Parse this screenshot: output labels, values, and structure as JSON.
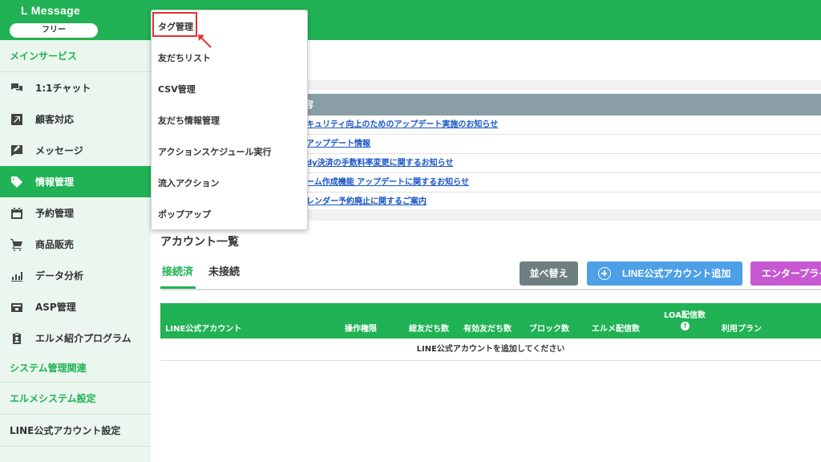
{
  "brand": {
    "name": "L Message",
    "plan": "フリー"
  },
  "sidebar": {
    "main_section": "メインサービス",
    "items": [
      {
        "label": "1:1チャット",
        "icon": "chat-icon"
      },
      {
        "label": "顧客対応",
        "icon": "external-link-icon"
      },
      {
        "label": "メッセージ",
        "icon": "message-edit-icon"
      },
      {
        "label": "情報管理",
        "icon": "tag-icon"
      },
      {
        "label": "予約管理",
        "icon": "calendar-icon"
      },
      {
        "label": "商品販売",
        "icon": "cart-icon"
      },
      {
        "label": "データ分析",
        "icon": "chart-icon"
      },
      {
        "label": "ASP管理",
        "icon": "wallet-icon"
      },
      {
        "label": "エルメ紹介プログラム",
        "icon": "badge-icon"
      }
    ],
    "system_section": "システム管理関連",
    "system_items": [
      {
        "label": "エルメシステム設定"
      },
      {
        "label": "LINE公式アカウント設定"
      }
    ]
  },
  "notices": {
    "header": "容",
    "rows": [
      "キュリティ向上のためのアップデート実施のお知らせ",
      "アップデート情報",
      "dy決済の手数料率変更に関するお知らせ",
      "ーム作成機能 アップデートに関するお知らせ",
      "レンダー予約廃止に関するご案内"
    ]
  },
  "accounts": {
    "title": "アカウント一覧",
    "tabs": [
      "接続済",
      "未接続"
    ],
    "buttons": {
      "sort": "並べ替え",
      "add": "LINE公式アカウント追加",
      "enterprise": "エンタープライ"
    },
    "table": {
      "headers": {
        "account": "LINE公式アカウント",
        "permission": "操作権限",
        "total_friends": "総友だち数",
        "valid_friends": "有効友だち数",
        "blocked": "ブロック数",
        "delivered": "エルメ配信数",
        "loa": "LOA配信数",
        "plan": "利用プラン"
      },
      "empty_message": "LINE公式アカウントを追加してください"
    }
  },
  "dropdown": {
    "items": [
      "タグ管理",
      "友だちリスト",
      "CSV管理",
      "友だち情報管理",
      "アクションスケジュール実行",
      "流入アクション",
      "ポップアップ"
    ]
  },
  "colors": {
    "brand_green": "#20b254",
    "highlight_red": "#e53030",
    "link_blue": "#1a56c8"
  }
}
